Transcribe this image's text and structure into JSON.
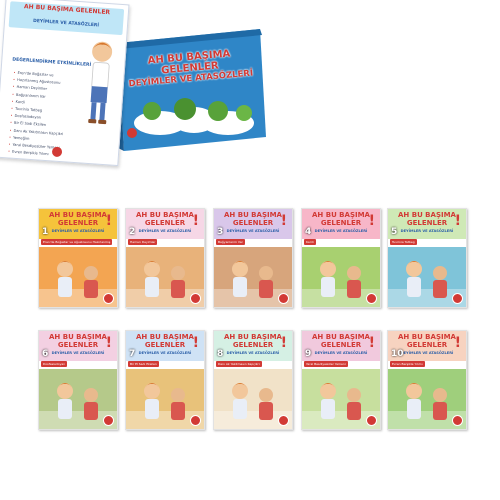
{
  "box_set": {
    "title_line1": "AH BU BAŞIMA",
    "title_line2": "GELENLER",
    "subtitle": "DEYİMLER VE ATASÖZLERİ",
    "colors": {
      "box": "#2f86c7",
      "title": "#d23a35",
      "cloud": "#ffffff",
      "tree": "#58a23a"
    }
  },
  "back_card": {
    "title_line1": "AH BU BAŞIMA GELENLER",
    "subtitle": "DEYİMLER VE ATASÖZLERİ",
    "list_heading": "DEĞERLENDİRME ETKİNLİKLERİ",
    "items": [
      "Eren'de Boğazlar ve",
      "Hazırlanmış Ağustosunu",
      "Hamarı Deyimler",
      "Bağyanlarım Var",
      "Kardi",
      "Tuvrinia Tatbeg",
      "Dosfasiadoyan",
      "Bir El Sadı Eksilen",
      "Danı Ak Yakıtmasın Kapçikri",
      "Yemeğim",
      "Yaral Besdiyesizler Yemeni",
      "Evren Berşikle Yılımı"
    ]
  },
  "books": [
    {
      "number": "1",
      "title_line1": "AH BU BAŞIMA",
      "title_line2": "GELENLER",
      "series": "DEYİMLER VE ATASÖZLERİ",
      "ribbon": "Eren'de Boğazlar ve Ağustosunu Hazırlanmış",
      "top_color": "#f5c33b",
      "scene_color": "#f3a552"
    },
    {
      "number": "2",
      "title_line1": "AH BU BAŞIMA",
      "title_line2": "GELENLER",
      "series": "DEYİMLER VE ATASÖZLERİ",
      "ribbon": "Hamarı Deyimler",
      "top_color": "#f6d7e6",
      "scene_color": "#e8b27a"
    },
    {
      "number": "3",
      "title_line1": "AH BU BAŞIMA",
      "title_line2": "GELENLER",
      "series": "DEYİMLER VE ATASÖZLERİ",
      "ribbon": "Bağyanlarım Var",
      "top_color": "#d9c7ea",
      "scene_color": "#d7a57c"
    },
    {
      "number": "4",
      "title_line1": "AH BU BAŞIMA",
      "title_line2": "GELENLER",
      "series": "DEYİMLER VE ATASÖZLERİ",
      "ribbon": "Kardi",
      "top_color": "#f7b6c8",
      "scene_color": "#a8d070"
    },
    {
      "number": "5",
      "title_line1": "AH BU BAŞIMA",
      "title_line2": "GELENLER",
      "series": "DEYİMLER VE ATASÖZLERİ",
      "ribbon": "Tuvrinia Tatbeg",
      "top_color": "#cfe9b6",
      "scene_color": "#7fc4d9"
    },
    {
      "number": "6",
      "title_line1": "AH BU BAŞIMA",
      "title_line2": "GELENLER",
      "series": "DEYİMLER VE ATASÖZLERİ",
      "ribbon": "Dosfasiadoyan",
      "top_color": "#f3d0e2",
      "scene_color": "#b5c98a"
    },
    {
      "number": "7",
      "title_line1": "AH BU BAŞIMA",
      "title_line2": "GELENLER",
      "series": "DEYİMLER VE ATASÖZLERİ",
      "ribbon": "Bir El Sadı Eksilen",
      "top_color": "#cfe2f5",
      "scene_color": "#e8c27a"
    },
    {
      "number": "8",
      "title_line1": "AH BU BAŞIMA",
      "title_line2": "GELENLER",
      "series": "DEYİMLER VE ATASÖZLERİ",
      "ribbon": "Danı Ak Yakıtmasın Kapçikri",
      "top_color": "#d5f0e4",
      "scene_color": "#f1e2c8"
    },
    {
      "number": "9",
      "title_line1": "AH BU BAŞIMA",
      "title_line2": "GELENLER",
      "series": "DEYİMLER VE ATASÖZLERİ",
      "ribbon": "Yaral Besdiyesizler Yemeni",
      "top_color": "#f1c9dd",
      "scene_color": "#c7df9e"
    },
    {
      "number": "10",
      "title_line1": "AH BU BAŞIMA",
      "title_line2": "GELENLER",
      "series": "DEYİMLER VE ATASÖZLERİ",
      "ribbon": "Evren Berşikle Yılımı",
      "top_color": "#f7d3c0",
      "scene_color": "#9fcf7c"
    }
  ]
}
